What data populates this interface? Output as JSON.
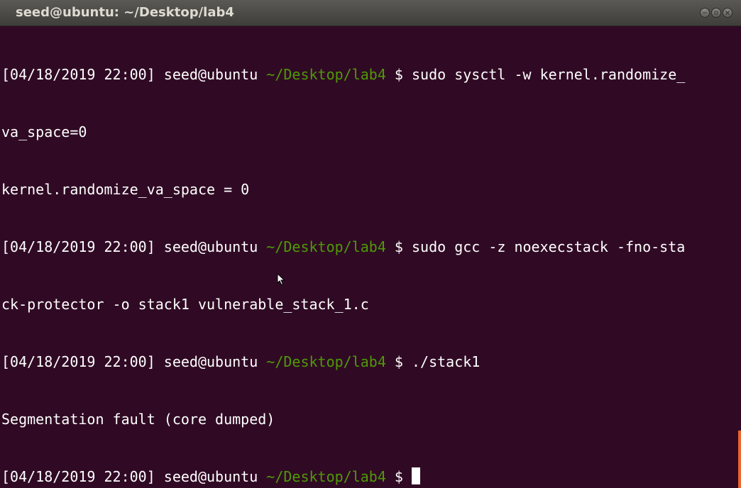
{
  "window": {
    "title": "seed@ubuntu: ~/Desktop/lab4"
  },
  "terminal": {
    "prompt_prefix": "[04/18/2019 22:00] seed@ubuntu ",
    "prompt_path": "~/Desktop/lab4",
    "prompt_suffix": " $ ",
    "lines": [
      "sudo sysctl -w kernel.randomize_",
      "va_space=0",
      "kernel.randomize_va_space = 0",
      "sudo gcc -z noexecstack -fno-sta",
      "ck-protector -o stack1 vulnerable_stack_1.c",
      "./stack1",
      "Segmentation fault (core dumped)"
    ]
  },
  "colors": {
    "background": "#300a24",
    "path": "#4e9a06",
    "text": "#ffffff"
  },
  "icons": {
    "minimize": "minimize-icon",
    "maximize": "maximize-icon",
    "close": "close-icon",
    "pointer": "mouse-pointer-icon"
  }
}
